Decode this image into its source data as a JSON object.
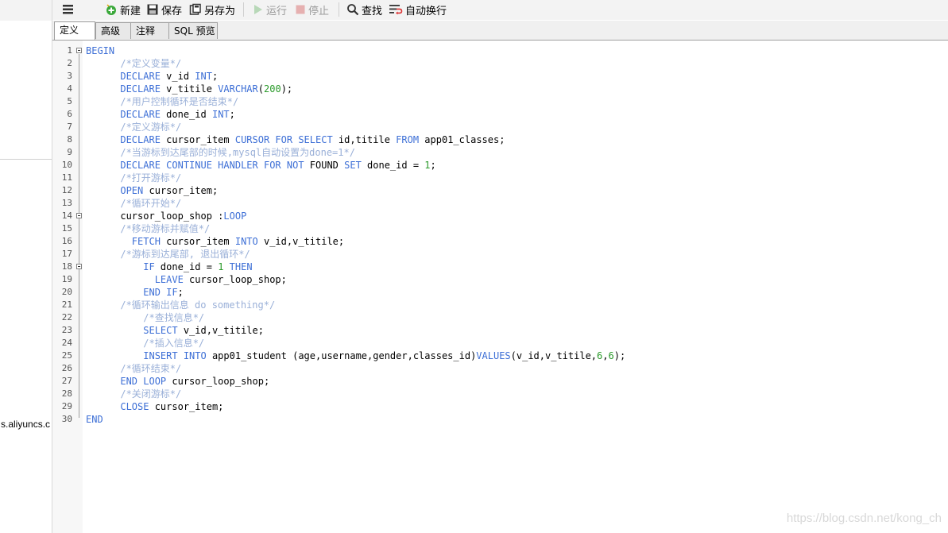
{
  "left_panel": {
    "host_text": "s.aliyuncs.c"
  },
  "toolbar": {
    "menu_icon": "hamburger-icon",
    "new_label": "新建",
    "save_label": "保存",
    "save_as_label": "另存为",
    "run_label": "运行",
    "stop_label": "停止",
    "find_label": "查找",
    "wrap_label": "自动换行"
  },
  "tabs": [
    {
      "label": "定义",
      "active": true
    },
    {
      "label": "高级",
      "active": false
    },
    {
      "label": "注释",
      "active": false
    },
    {
      "label": "SQL 预览",
      "active": false
    }
  ],
  "editor": {
    "lines": [
      {
        "n": "1",
        "fold": true,
        "tokens": [
          [
            "kw",
            "BEGIN"
          ]
        ]
      },
      {
        "n": "2",
        "fold": false,
        "tokens": [
          [
            "",
            "      "
          ],
          [
            "cm",
            "/*定义变量*/"
          ]
        ]
      },
      {
        "n": "3",
        "fold": false,
        "tokens": [
          [
            "",
            "      "
          ],
          [
            "kw",
            "DECLARE"
          ],
          [
            "",
            " v_id "
          ],
          [
            "kw",
            "INT"
          ],
          [
            "",
            ";"
          ]
        ]
      },
      {
        "n": "4",
        "fold": false,
        "tokens": [
          [
            "",
            "      "
          ],
          [
            "kw",
            "DECLARE"
          ],
          [
            "",
            " v_titile "
          ],
          [
            "kw",
            "VARCHAR"
          ],
          [
            "",
            "("
          ],
          [
            "nm",
            "200"
          ],
          [
            "",
            ");"
          ]
        ]
      },
      {
        "n": "5",
        "fold": false,
        "tokens": [
          [
            "",
            "      "
          ],
          [
            "cm",
            "/*用户控制循环是否结束*/"
          ]
        ]
      },
      {
        "n": "6",
        "fold": false,
        "tokens": [
          [
            "",
            "      "
          ],
          [
            "kw",
            "DECLARE"
          ],
          [
            "",
            " done_id "
          ],
          [
            "kw",
            "INT"
          ],
          [
            "",
            ";"
          ]
        ]
      },
      {
        "n": "7",
        "fold": false,
        "tokens": [
          [
            "",
            "      "
          ],
          [
            "cm",
            "/*定义游标*/"
          ]
        ]
      },
      {
        "n": "8",
        "fold": false,
        "tokens": [
          [
            "",
            "      "
          ],
          [
            "kw",
            "DECLARE"
          ],
          [
            "",
            " cursor_item "
          ],
          [
            "kw",
            "CURSOR FOR SELECT"
          ],
          [
            "",
            " id,titile "
          ],
          [
            "kw",
            "FROM"
          ],
          [
            "",
            " app01_classes;"
          ]
        ]
      },
      {
        "n": "9",
        "fold": false,
        "tokens": [
          [
            "",
            "      "
          ],
          [
            "cm",
            "/*当游标到达尾部的时候,mysql自动设置为done=1*/"
          ]
        ]
      },
      {
        "n": "10",
        "fold": false,
        "tokens": [
          [
            "",
            "      "
          ],
          [
            "kw",
            "DECLARE CONTINUE HANDLER FOR NOT"
          ],
          [
            "",
            " FOUND "
          ],
          [
            "kw",
            "SET"
          ],
          [
            "",
            " done_id = "
          ],
          [
            "nm",
            "1"
          ],
          [
            "",
            ";"
          ]
        ]
      },
      {
        "n": "11",
        "fold": false,
        "tokens": [
          [
            "",
            "      "
          ],
          [
            "cm",
            "/*打开游标*/"
          ]
        ]
      },
      {
        "n": "12",
        "fold": false,
        "tokens": [
          [
            "",
            "      "
          ],
          [
            "kw",
            "OPEN"
          ],
          [
            "",
            " cursor_item;"
          ]
        ]
      },
      {
        "n": "13",
        "fold": false,
        "tokens": [
          [
            "",
            "      "
          ],
          [
            "cm",
            "/*循环开始*/"
          ]
        ]
      },
      {
        "n": "14",
        "fold": true,
        "tokens": [
          [
            "",
            "      cursor_loop_shop :"
          ],
          [
            "kw",
            "LOOP"
          ]
        ]
      },
      {
        "n": "15",
        "fold": false,
        "tokens": [
          [
            "",
            "      "
          ],
          [
            "cm",
            "/*移动游标并赋值*/"
          ]
        ]
      },
      {
        "n": "16",
        "fold": false,
        "tokens": [
          [
            "",
            "        "
          ],
          [
            "kw",
            "FETCH"
          ],
          [
            "",
            " cursor_item "
          ],
          [
            "kw",
            "INTO"
          ],
          [
            "",
            " v_id,v_titile;"
          ]
        ]
      },
      {
        "n": "17",
        "fold": false,
        "tokens": [
          [
            "",
            "      "
          ],
          [
            "cm",
            "/*游标到达尾部, 退出循环*/"
          ]
        ]
      },
      {
        "n": "18",
        "fold": true,
        "tokens": [
          [
            "",
            "          "
          ],
          [
            "kw",
            "IF"
          ],
          [
            "",
            " done_id = "
          ],
          [
            "nm",
            "1"
          ],
          [
            "",
            " "
          ],
          [
            "kw",
            "THEN"
          ]
        ]
      },
      {
        "n": "19",
        "fold": false,
        "tokens": [
          [
            "",
            "            "
          ],
          [
            "kw",
            "LEAVE"
          ],
          [
            "",
            " cursor_loop_shop;"
          ]
        ]
      },
      {
        "n": "20",
        "fold": false,
        "tokens": [
          [
            "",
            "          "
          ],
          [
            "kw",
            "END IF"
          ],
          [
            "",
            ";"
          ]
        ]
      },
      {
        "n": "21",
        "fold": false,
        "tokens": [
          [
            "",
            "      "
          ],
          [
            "cm",
            "/*循环输出信息 do something*/"
          ]
        ]
      },
      {
        "n": "22",
        "fold": false,
        "tokens": [
          [
            "",
            "          "
          ],
          [
            "cm",
            "/*查找信息*/"
          ]
        ]
      },
      {
        "n": "23",
        "fold": false,
        "tokens": [
          [
            "",
            "          "
          ],
          [
            "kw",
            "SELECT"
          ],
          [
            "",
            " v_id,v_titile;"
          ]
        ]
      },
      {
        "n": "24",
        "fold": false,
        "tokens": [
          [
            "",
            "          "
          ],
          [
            "cm",
            "/*插入信息*/"
          ]
        ]
      },
      {
        "n": "25",
        "fold": false,
        "tokens": [
          [
            "",
            "          "
          ],
          [
            "kw",
            "INSERT INTO"
          ],
          [
            "",
            " app01_student (age,username,gender,classes_id)"
          ],
          [
            "kw",
            "VALUES"
          ],
          [
            "",
            "(v_id,v_titile,"
          ],
          [
            "nm",
            "6"
          ],
          [
            "",
            ","
          ],
          [
            "nm",
            "6"
          ],
          [
            "",
            ");"
          ]
        ]
      },
      {
        "n": "26",
        "fold": false,
        "tokens": [
          [
            "",
            "      "
          ],
          [
            "cm",
            "/*循环结束*/"
          ]
        ]
      },
      {
        "n": "27",
        "fold": false,
        "tokens": [
          [
            "",
            "      "
          ],
          [
            "kw",
            "END LOOP"
          ],
          [
            "",
            " cursor_loop_shop;"
          ]
        ]
      },
      {
        "n": "28",
        "fold": false,
        "tokens": [
          [
            "",
            "      "
          ],
          [
            "cm",
            "/*关闭游标*/"
          ]
        ]
      },
      {
        "n": "29",
        "fold": false,
        "tokens": [
          [
            "",
            "      "
          ],
          [
            "kw",
            "CLOSE"
          ],
          [
            "",
            " cursor_item;"
          ]
        ]
      },
      {
        "n": "30",
        "fold": false,
        "tokens": [
          [
            "kw",
            "END"
          ]
        ]
      }
    ]
  },
  "watermark": "https://blog.csdn.net/kong_ch",
  "colors": {
    "keyword": "#3d6fd6",
    "comment": "#9ab0d8",
    "number": "#2a9a2a"
  }
}
